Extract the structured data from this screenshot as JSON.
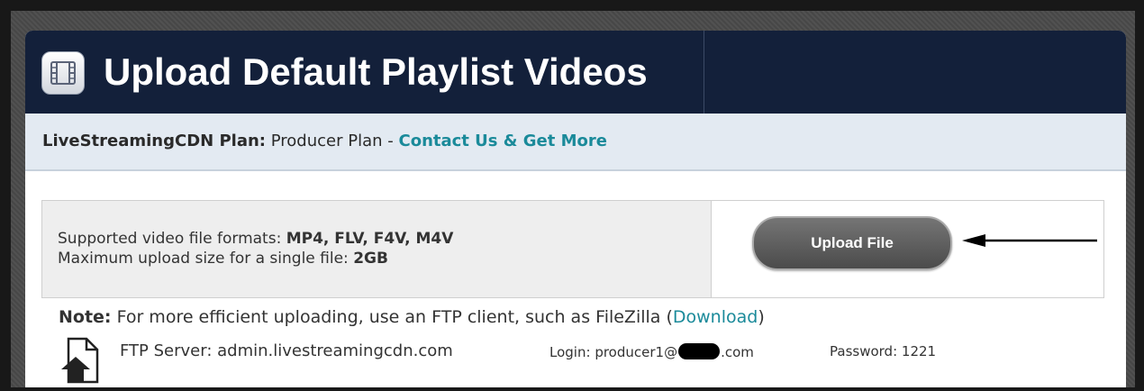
{
  "header": {
    "title": "Upload Default Playlist Videos",
    "icon": "film-icon",
    "background_color": "#13203a"
  },
  "plan_bar": {
    "label": "LiveStreamingCDN Plan:",
    "plan_name": "Producer Plan",
    "separator": "-",
    "contact_link": "Contact Us & Get More",
    "link_color": "#1a8a9a"
  },
  "info": {
    "formats_label": "Supported video file formats:",
    "formats_value": "MP4, FLV, F4V, M4V",
    "max_size_label": "Maximum upload size for a single file:",
    "max_size_value": "2GB"
  },
  "upload": {
    "button_label": "Upload File",
    "arrow_icon": "arrow-left-icon"
  },
  "note": {
    "label": "Note:",
    "text": "For more efficient uploading, use an FTP client, such as FileZilla (",
    "link": "Download",
    "close": ")"
  },
  "ftp": {
    "icon": "upload-file-icon",
    "server_label": "FTP Server:",
    "server_value": "admin.livestreamingcdn.com",
    "login_label": "Login:",
    "login_prefix": "producer1@",
    "login_suffix": ".com",
    "password_label": "Password:",
    "password_value": "1221"
  }
}
